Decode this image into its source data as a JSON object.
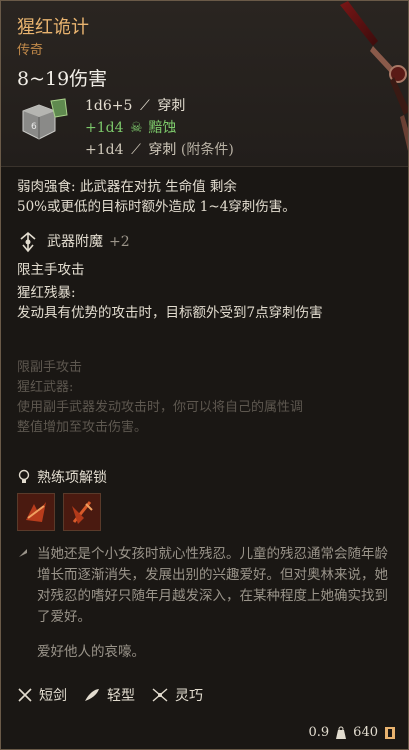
{
  "item": {
    "name": "猩红诡计",
    "rarity": "传奇",
    "damage_range": "8~19伤害",
    "damage_lines": [
      {
        "dice": "1d6+5",
        "type": "穿刺"
      },
      {
        "dice": "+1d4",
        "type": "黯蚀"
      },
      {
        "dice": "+1d4",
        "type": "穿刺",
        "note": "(附条件)"
      }
    ]
  },
  "description": {
    "line1": "弱肉强食: 此武器在对抗 生命值 剩余",
    "line2": "50%或更低的目标时额外造成 1~4穿刺伤害。"
  },
  "enchant": {
    "label": "武器附魔",
    "value": "+2"
  },
  "mainhand": "限主手攻击",
  "ability": {
    "name": "猩红残暴:",
    "text": "发动具有优势的攻击时，目标额外受到7点穿刺伤害"
  },
  "offhand": {
    "restriction": "限副手攻击",
    "name": "猩红武器:",
    "text1": "使用副手武器发动攻击时，你可以将自己的属性调",
    "text2": "整值增加至攻击伤害。"
  },
  "proficiency": {
    "label": "熟练项解锁"
  },
  "lore": {
    "text": "当她还是个小女孩时就心性残忍。儿童的残忍通常会随年龄增长而逐渐消失，发展出别的兴趣爱好。但对奥林来说，她对残忍的嗜好只随年月越发深入，在某种程度上她确实找到了爱好。",
    "quote": "爱好他人的哀嚎。"
  },
  "tags": [
    "短剑",
    "轻型",
    "灵巧"
  ],
  "footer": {
    "weight": "0.9",
    "value": "640"
  },
  "colors": {
    "title": "#e8b36f",
    "rarity": "#c28a4a",
    "necrotic": "#7cc86a",
    "faded": "#5d574f"
  }
}
